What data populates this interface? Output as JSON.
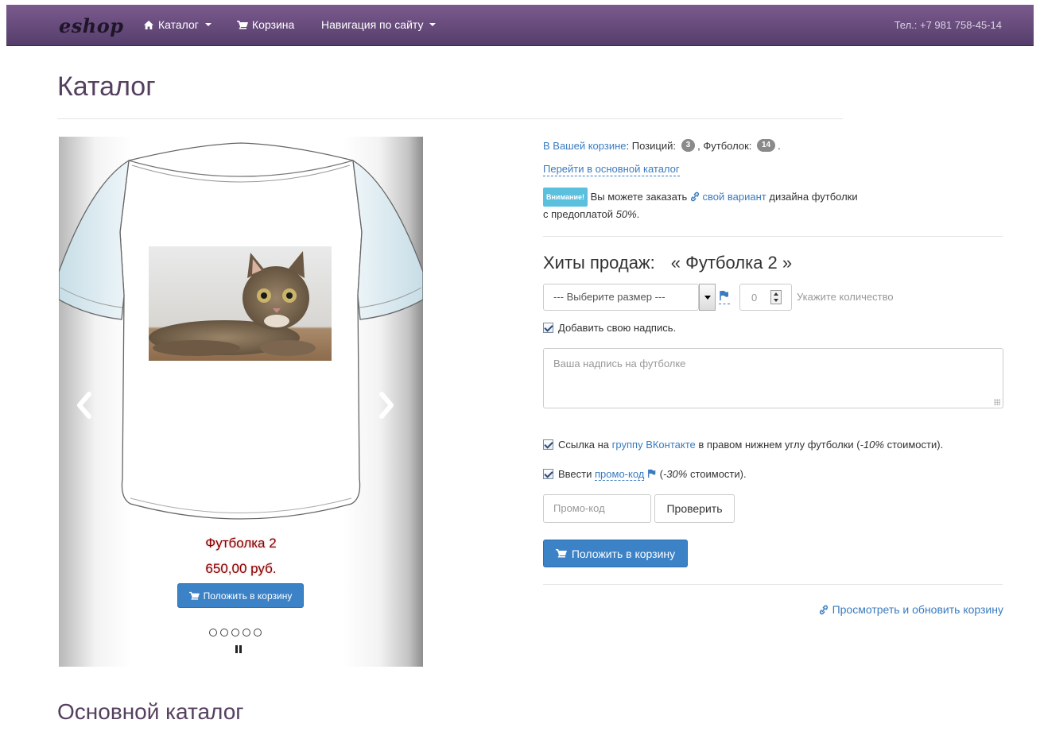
{
  "navbar": {
    "brand": "eshop",
    "catalog_label": "Каталог",
    "cart_label": "Корзина",
    "site_nav_label": "Навигация по сайту",
    "phone": "Тел.: +7 981 758-45-14"
  },
  "page": {
    "title": "Каталог",
    "section_title": "Основной каталог"
  },
  "carousel": {
    "product_name": "Футболка 2",
    "product_price": "650,00 руб.",
    "add_to_cart_label": "Положить в корзину",
    "indicator_count": 5
  },
  "cart_info": {
    "link_text": "В Вашей корзине",
    "positions_label": ": Позиций:",
    "positions_count": "3",
    "tshirts_label": ", Футболок:",
    "tshirts_count": "14",
    "tail": ".",
    "goto_catalog": "Перейти в основной каталог"
  },
  "attention": {
    "badge": "Внимание!",
    "text_before": "Вы можете заказать",
    "link": "свой вариант",
    "text_after": "дизайна футболки",
    "line2_before": "с предоплатой",
    "line2_pct": "50%",
    "line2_after": "."
  },
  "order": {
    "hits_label": "Хиты продаж:",
    "product_title": "« Футболка 2 »",
    "size_placeholder": "--- Выберите размер ---",
    "qty_value": "0",
    "qty_hint": "Укажите количество",
    "add_caption_label": "Добавить свою надпись.",
    "caption_placeholder": "Ваша надпись на футболке",
    "vk_text_before": "Ссылка на",
    "vk_link": "группу ВКонтакте",
    "vk_text_after": "в правом нижнем углу футболки (",
    "vk_pct": "-10%",
    "vk_text_end": "стоимости).",
    "promo_text_before": "Ввести",
    "promo_link": "промо-код",
    "promo_open": "(",
    "promo_pct": "-30%",
    "promo_text_end": "стоимости).",
    "promo_placeholder": "Промо-код",
    "check_button": "Проверить",
    "add_to_cart_button": "Положить в корзину",
    "view_cart_link": "Просмотреть и обновить корзину"
  },
  "colors": {
    "navbar": "#553e6b",
    "link": "#3a7bbf",
    "primary_button": "#3b82c7",
    "heading": "#55405f",
    "price": "#8b0000"
  }
}
